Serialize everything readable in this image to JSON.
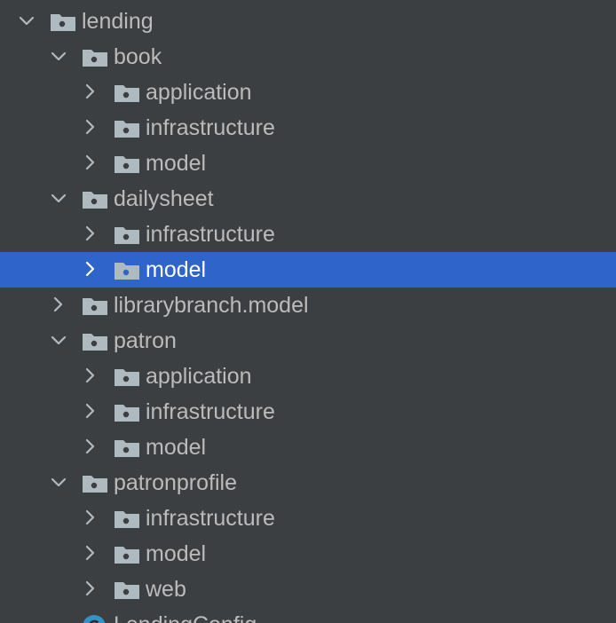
{
  "theme": {
    "background": "#3c3f41",
    "selection": "#2f65ca",
    "text": "#bbbbbb",
    "selected_text": "#ffffff",
    "icon": "#aeb9c0",
    "icon_dot": "#3c3f41",
    "class_icon": "#3592c4"
  },
  "tree": {
    "items": [
      {
        "label": "lending",
        "depth": 0,
        "state": "expanded",
        "icon": "package-folder-icon",
        "selected": false
      },
      {
        "label": "book",
        "depth": 1,
        "state": "expanded",
        "icon": "package-folder-icon",
        "selected": false
      },
      {
        "label": "application",
        "depth": 2,
        "state": "collapsed",
        "icon": "package-folder-icon",
        "selected": false
      },
      {
        "label": "infrastructure",
        "depth": 2,
        "state": "collapsed",
        "icon": "package-folder-icon",
        "selected": false
      },
      {
        "label": "model",
        "depth": 2,
        "state": "collapsed",
        "icon": "package-folder-icon",
        "selected": false
      },
      {
        "label": "dailysheet",
        "depth": 1,
        "state": "expanded",
        "icon": "package-folder-icon",
        "selected": false
      },
      {
        "label": "infrastructure",
        "depth": 2,
        "state": "collapsed",
        "icon": "package-folder-icon",
        "selected": false
      },
      {
        "label": "model",
        "depth": 2,
        "state": "collapsed",
        "icon": "package-folder-icon",
        "selected": true
      },
      {
        "label": "librarybranch.model",
        "depth": 1,
        "state": "collapsed",
        "icon": "package-folder-icon",
        "selected": false
      },
      {
        "label": "patron",
        "depth": 1,
        "state": "expanded",
        "icon": "package-folder-icon",
        "selected": false
      },
      {
        "label": "application",
        "depth": 2,
        "state": "collapsed",
        "icon": "package-folder-icon",
        "selected": false
      },
      {
        "label": "infrastructure",
        "depth": 2,
        "state": "collapsed",
        "icon": "package-folder-icon",
        "selected": false
      },
      {
        "label": "model",
        "depth": 2,
        "state": "collapsed",
        "icon": "package-folder-icon",
        "selected": false
      },
      {
        "label": "patronprofile",
        "depth": 1,
        "state": "expanded",
        "icon": "package-folder-icon",
        "selected": false
      },
      {
        "label": "infrastructure",
        "depth": 2,
        "state": "collapsed",
        "icon": "package-folder-icon",
        "selected": false
      },
      {
        "label": "model",
        "depth": 2,
        "state": "collapsed",
        "icon": "package-folder-icon",
        "selected": false
      },
      {
        "label": "web",
        "depth": 2,
        "state": "collapsed",
        "icon": "package-folder-icon",
        "selected": false
      },
      {
        "label": "LendingConfig",
        "depth": 1,
        "state": "leaf",
        "icon": "java-class-icon",
        "selected": false
      }
    ]
  }
}
